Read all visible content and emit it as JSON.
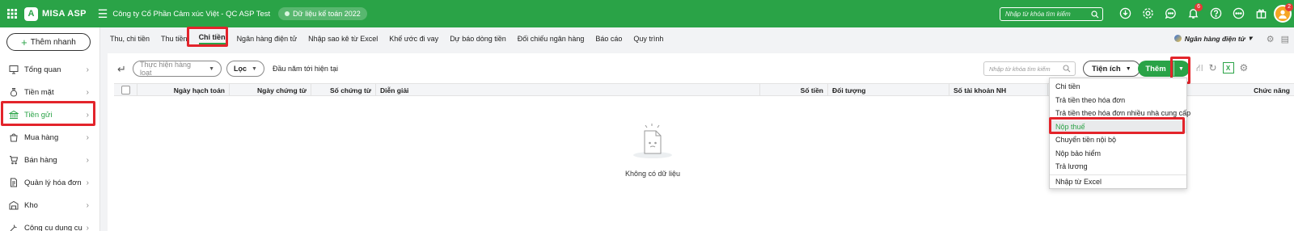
{
  "topbar": {
    "app_name": "MISA ASP",
    "logo_letter": "A",
    "company": "Công ty Cổ Phần Cảm xúc Việt - QC ASP Test",
    "data_badge": "Dữ liệu kế toán 2022",
    "search_placeholder": "Nhập từ khóa tìm kiếm",
    "notification_count": "6",
    "avatar_count": "2",
    "accent_color": "#2aa347"
  },
  "sidebar": {
    "quick_add_label": "Thêm nhanh",
    "items": [
      {
        "label": "Tổng quan",
        "icon": "monitor-icon"
      },
      {
        "label": "Tiền mặt",
        "icon": "money-bag-icon"
      },
      {
        "label": "Tiền gửi",
        "icon": "bank-icon",
        "active": true
      },
      {
        "label": "Mua hàng",
        "icon": "shopping-bag-icon"
      },
      {
        "label": "Bán hàng",
        "icon": "cart-icon"
      },
      {
        "label": "Quản lý hóa đơn",
        "icon": "invoice-icon"
      },
      {
        "label": "Kho",
        "icon": "warehouse-icon"
      },
      {
        "label": "Công cụ dụng cụ",
        "icon": "tools-icon"
      }
    ]
  },
  "tabs": [
    {
      "label": "Thu, chi tiền"
    },
    {
      "label": "Thu tiền"
    },
    {
      "label": "Chi tiền",
      "active": true
    },
    {
      "label": "Ngân hàng điện tử"
    },
    {
      "label": "Nhập sao kê từ Excel"
    },
    {
      "label": "Khế ước đi vay"
    },
    {
      "label": "Dự báo dòng tiền"
    },
    {
      "label": "Đối chiếu ngân hàng"
    },
    {
      "label": "Báo cáo"
    },
    {
      "label": "Quy trình"
    }
  ],
  "bank_select_label": "Ngân hàng điện tử",
  "toolbar": {
    "record_type_placeholder": "Thực hiện hàng loạt",
    "filter_label": "Lọc",
    "period_text": "Đầu năm tới hiện tại",
    "search_placeholder": "Nhập từ khóa tìm kiếm",
    "utility_label": "Tiện ích",
    "add_label": "Thêm",
    "excel_letter": "X"
  },
  "table": {
    "columns": [
      "Ngày hạch toán",
      "Ngày chứng từ",
      "Số chứng từ",
      "Diễn giải",
      "Số tiền",
      "Đối tượng",
      "Số tài khoản NH",
      "Chức năng"
    ]
  },
  "empty_text": "Không có dữ liệu",
  "add_menu": {
    "items": [
      "Chi tiền",
      "Trả tiền theo hóa đơn",
      "Trả tiền theo hóa đơn nhiều nhà cung cấp",
      "Nộp thuế",
      "Chuyển tiền nội bộ",
      "Nộp bảo hiểm",
      "Trả lương",
      "Nhập từ Excel"
    ],
    "highlighted": "Nộp thuế"
  }
}
